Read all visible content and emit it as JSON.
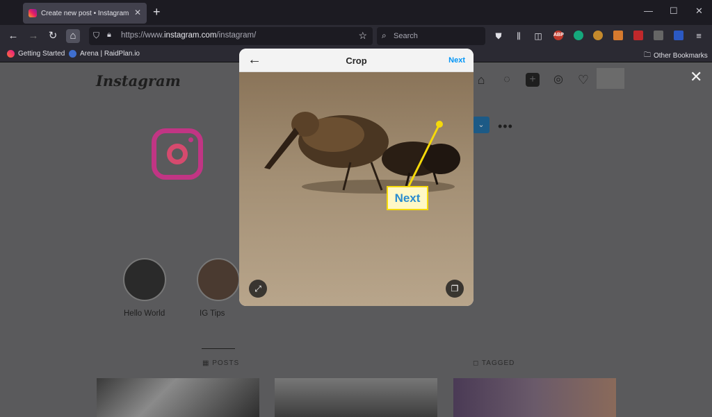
{
  "browser": {
    "tab_title": "Create new post • Instagram",
    "url_prefix": "https://www.",
    "url_host": "instagram.com",
    "url_path": "/instagram/",
    "search_placeholder": "Search",
    "bookmarks": [
      "Getting Started",
      "Arena | RaidPlan.io"
    ],
    "other_bookmarks": "Other Bookmarks",
    "extensions": [
      "ABP"
    ]
  },
  "instagram": {
    "logo": "Instagram",
    "highlights": [
      "Hello World",
      "IG Tips"
    ],
    "tabs": [
      "POSTS",
      "TAGGED"
    ]
  },
  "modal": {
    "title": "Crop",
    "next_label": "Next"
  },
  "callout": {
    "label": "Next",
    "color": "#f5d90a"
  },
  "icons": [
    "back-arrow-icon",
    "forward-arrow-icon",
    "reload-icon",
    "home-icon",
    "shield-icon",
    "lock-icon",
    "star-icon",
    "search-icon",
    "pocket-icon",
    "library-icon",
    "sidebar-icon",
    "menu-icon",
    "home-icon",
    "messenger-icon",
    "new-post-icon",
    "explore-icon",
    "heart-icon",
    "close-icon",
    "expand-icon",
    "multi-select-icon"
  ]
}
